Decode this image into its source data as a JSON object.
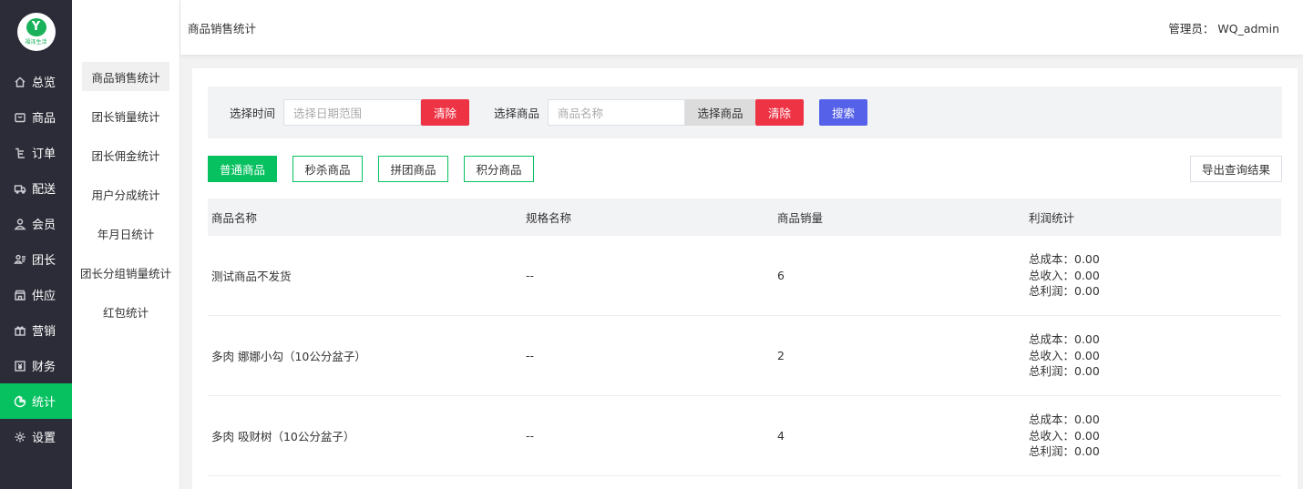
{
  "logo": {
    "mark": "Y",
    "text": "福泽生活"
  },
  "nav": [
    {
      "label": "总览",
      "icon": "home-icon",
      "active": false
    },
    {
      "label": "商品",
      "icon": "goods-icon",
      "active": false
    },
    {
      "label": "订单",
      "icon": "order-icon",
      "active": false
    },
    {
      "label": "配送",
      "icon": "delivery-icon",
      "active": false
    },
    {
      "label": "会员",
      "icon": "user-icon",
      "active": false
    },
    {
      "label": "团长",
      "icon": "group-leader-icon",
      "active": false
    },
    {
      "label": "供应",
      "icon": "supply-icon",
      "active": false
    },
    {
      "label": "营销",
      "icon": "gift-icon",
      "active": false
    },
    {
      "label": "财务",
      "icon": "finance-icon",
      "active": false
    },
    {
      "label": "统计",
      "icon": "pie-chart-icon",
      "active": true
    },
    {
      "label": "设置",
      "icon": "gear-icon",
      "active": false
    }
  ],
  "subnav": [
    {
      "label": "商品销售统计",
      "active": true
    },
    {
      "label": "团长销量统计",
      "active": false
    },
    {
      "label": "团长佣金统计",
      "active": false
    },
    {
      "label": "用户分成统计",
      "active": false
    },
    {
      "label": "年月日统计",
      "active": false
    },
    {
      "label": "团长分组销量统计",
      "active": false
    },
    {
      "label": "红包统计",
      "active": false
    }
  ],
  "header": {
    "title": "商品销售统计",
    "admin": "管理员： WQ_admin"
  },
  "filter": {
    "time_label": "选择时间",
    "date_placeholder": "选择日期范围",
    "clear1": "清除",
    "goods_label": "选择商品",
    "goods_placeholder": "商品名称",
    "select_goods": "选择商品",
    "clear2": "清除",
    "search": "搜索"
  },
  "tabs": [
    {
      "label": "普通商品",
      "active": true
    },
    {
      "label": "秒杀商品",
      "active": false
    },
    {
      "label": "拼团商品",
      "active": false
    },
    {
      "label": "积分商品",
      "active": false
    }
  ],
  "export_label": "导出查询结果",
  "table": {
    "headers": [
      "商品名称",
      "规格名称",
      "商品销量",
      "利润统计"
    ],
    "rows": [
      {
        "name": "测试商品不发货",
        "spec": "--",
        "sales": "6",
        "cost": "总成本：0.00",
        "income": "总收入：0.00",
        "profit": "总利润：0.00"
      },
      {
        "name": "多肉 娜娜小勾（10公分盆子）",
        "spec": "--",
        "sales": "2",
        "cost": "总成本：0.00",
        "income": "总收入：0.00",
        "profit": "总利润：0.00"
      },
      {
        "name": "多肉 吸财树（10公分盆子）",
        "spec": "--",
        "sales": "4",
        "cost": "总成本：0.00",
        "income": "总收入：0.00",
        "profit": "总利润：0.00"
      }
    ]
  },
  "colors": {
    "accent_green": "#07c160",
    "sidebar_bg": "#2b2c37",
    "danger_red": "#ee3344",
    "primary_blue": "#5561e8"
  }
}
